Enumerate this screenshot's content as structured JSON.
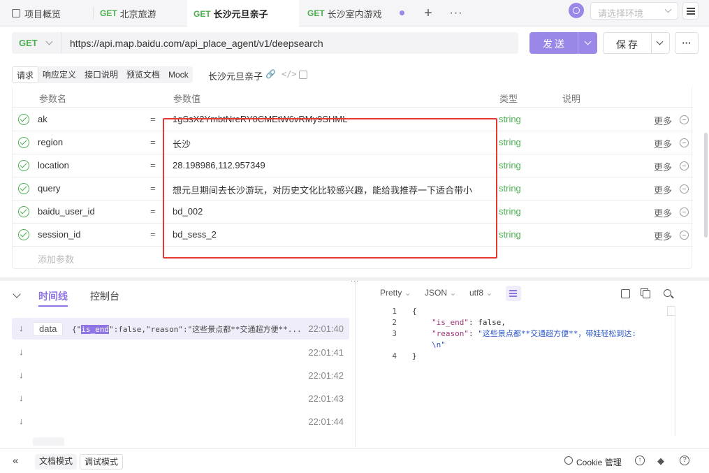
{
  "tabs": [
    {
      "method": "",
      "label": "项目概览"
    },
    {
      "method": "GET",
      "label": "北京旅游"
    },
    {
      "method": "GET",
      "label": "长沙元旦亲子"
    },
    {
      "method": "GET",
      "label": "长沙室内游戏"
    }
  ],
  "env": {
    "placeholder": "请选择环境"
  },
  "request": {
    "method": "GET",
    "url": "https://api.map.baidu.com/api_place_agent/v1/deepsearch",
    "send_label": "发送",
    "save_label": "保存"
  },
  "subtabs": [
    "请求",
    "响应定义",
    "接口说明",
    "预览文档",
    "Mock"
  ],
  "request_name": "长沙元旦亲子",
  "params": {
    "headers": {
      "name": "参数名",
      "value": "参数值",
      "type": "类型",
      "desc": "说明"
    },
    "rows": [
      {
        "name": "ak",
        "value": "1gSsX2YmbtNreRY0CMEtW6vRMy9SHML",
        "type": "string",
        "more": "更多"
      },
      {
        "name": "region",
        "value": "长沙",
        "type": "string",
        "more": "更多"
      },
      {
        "name": "location",
        "value": "28.198986,112.957349",
        "type": "string",
        "more": "更多"
      },
      {
        "name": "query",
        "value": "想元旦期间去长沙游玩，对历史文化比较感兴趣，能给我推荐一下适合带小",
        "type": "string",
        "more": "更多"
      },
      {
        "name": "baidu_user_id",
        "value": "bd_002",
        "type": "string",
        "more": "更多"
      },
      {
        "name": "session_id",
        "value": "bd_sess_2",
        "type": "string",
        "more": "更多"
      }
    ],
    "add_placeholder": "添加参数"
  },
  "bottom_tabs": {
    "timeline": "时间线",
    "console": "控制台"
  },
  "timeline": [
    {
      "tag": "data",
      "text_pre": "{\"",
      "text_hl": "is_end",
      "text_post": "\":false,\"reason\":\"这些景点都**交通超方便**...",
      "time": "22:01:40"
    },
    {
      "time": "22:01:41"
    },
    {
      "time": "22:01:42"
    },
    {
      "time": "22:01:43"
    },
    {
      "time": "22:01:44"
    }
  ],
  "viewer": {
    "format": "Pretty",
    "type": "JSON",
    "encoding": "utf8"
  },
  "code_lines": [
    {
      "n": "1",
      "text": "{"
    },
    {
      "n": "2",
      "key": "\"is_end\"",
      "rest": ": false,"
    },
    {
      "n": "3",
      "key": "\"reason\"",
      "rest": ": ",
      "str": "\"这些景点都**交通超方便**，带娃轻松到达:"
    },
    {
      "n": "",
      "str": "\\n\""
    },
    {
      "n": "4",
      "text": "}"
    }
  ],
  "status": {
    "doc_mode": "文档模式",
    "debug_mode": "调试模式",
    "cookie": "Cookie 管理"
  },
  "colors": {
    "accent": "#9b87e8",
    "get": "#4caf50",
    "highlight_box": "#e53935"
  }
}
